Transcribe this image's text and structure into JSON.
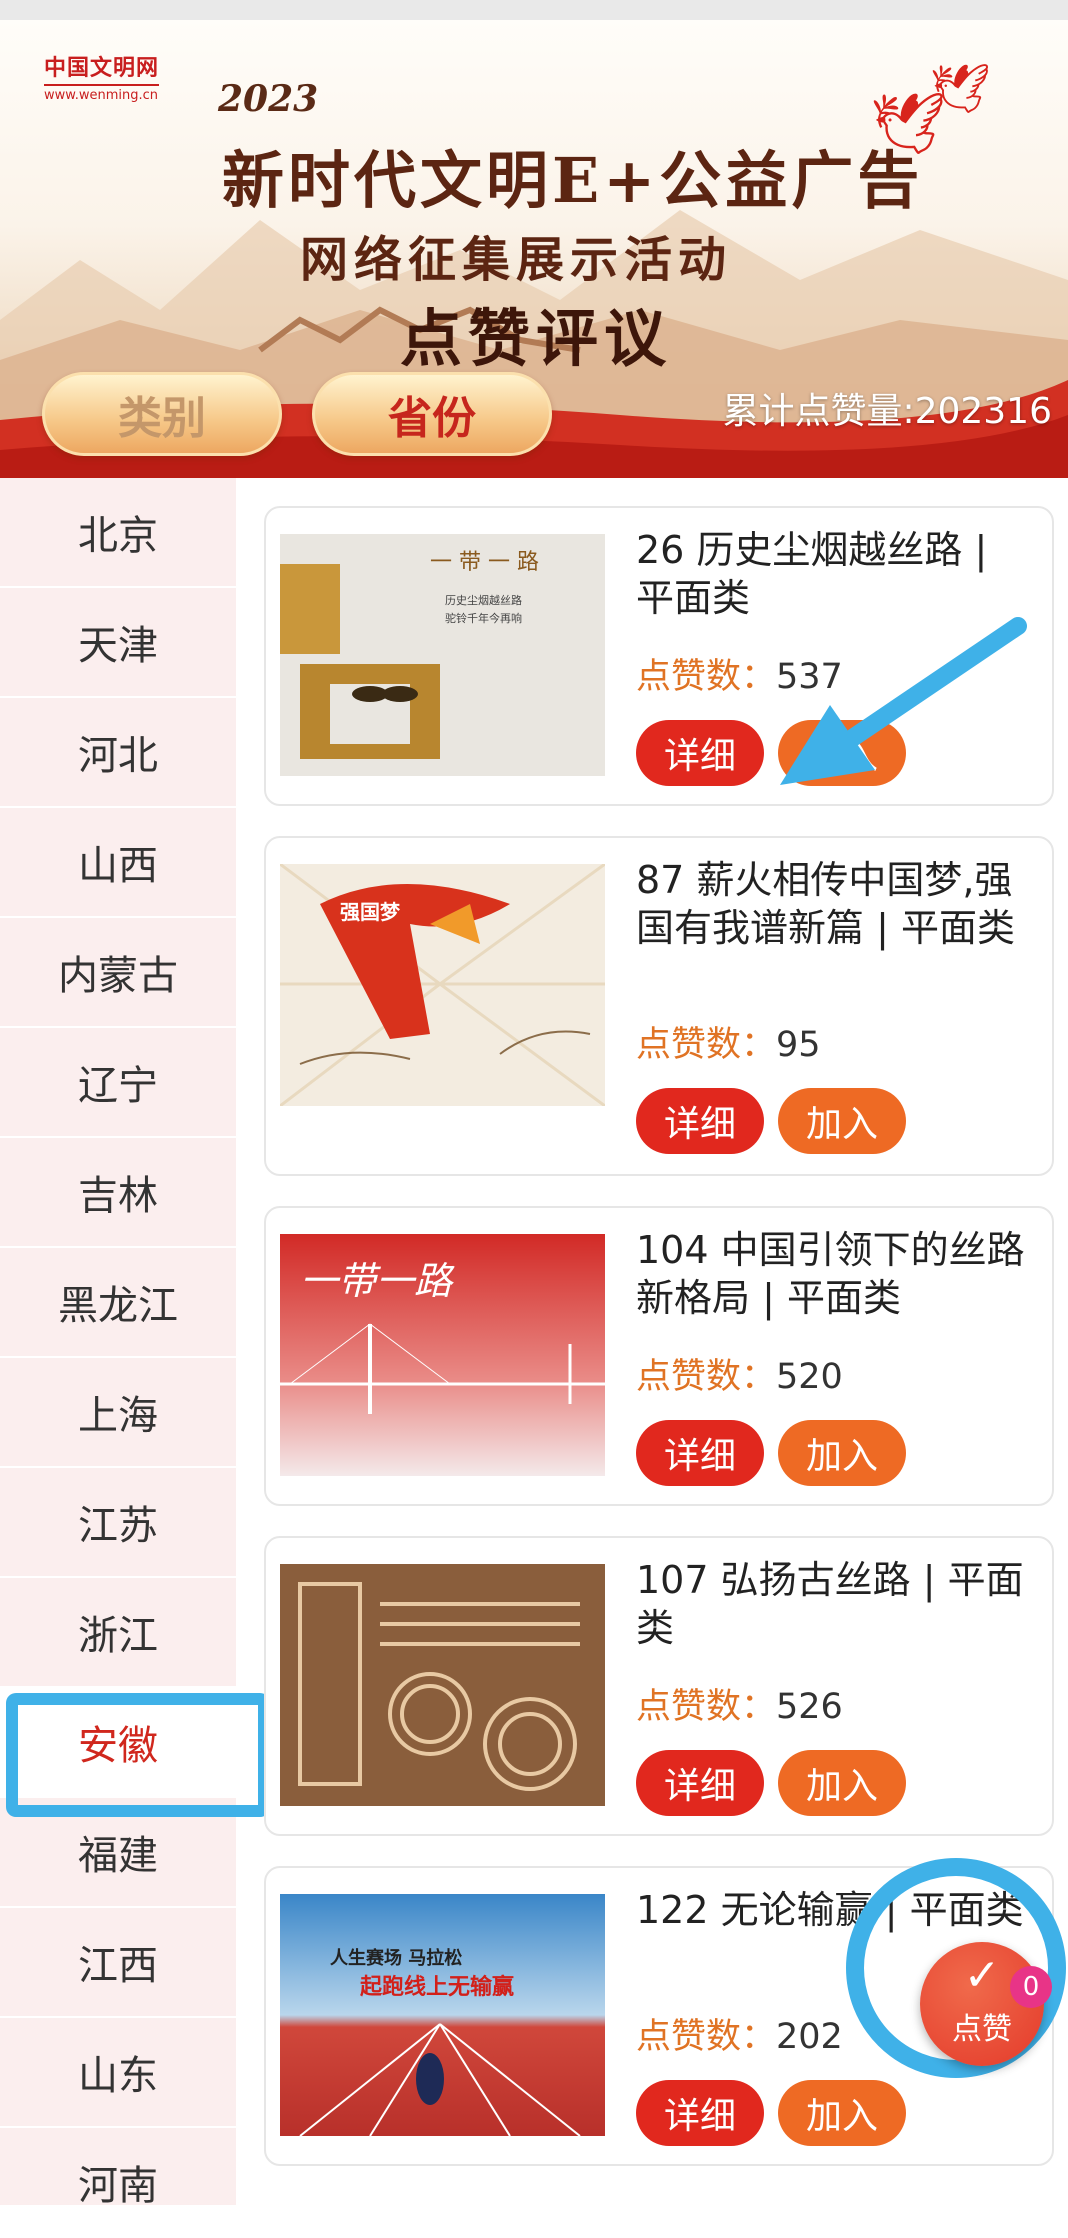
{
  "banner": {
    "logo_cn": "中国文明网",
    "logo_en": "www.wenming.cn",
    "year": "2023",
    "title_line1": "新时代文明E+公益广告",
    "title_line2": "网络征集展示活动",
    "title_line3": "点赞评议",
    "tab_category": "类别",
    "tab_province": "省份",
    "total_likes": "累计点赞量:202316"
  },
  "sidebar": {
    "items": [
      {
        "label": "北京"
      },
      {
        "label": "天津"
      },
      {
        "label": "河北"
      },
      {
        "label": "山西"
      },
      {
        "label": "内蒙古"
      },
      {
        "label": "辽宁"
      },
      {
        "label": "吉林"
      },
      {
        "label": "黑龙江"
      },
      {
        "label": "上海"
      },
      {
        "label": "江苏"
      },
      {
        "label": "浙江"
      },
      {
        "label": "安徽"
      },
      {
        "label": "福建"
      },
      {
        "label": "江西"
      },
      {
        "label": "山东"
      },
      {
        "label": "河南"
      }
    ],
    "active_index": 11
  },
  "cards": [
    {
      "title": "26 历史尘烟越丝路 | 平面类",
      "likes_label": "点赞数：",
      "likes": "537",
      "detail": "详细",
      "add": "加入"
    },
    {
      "title": "87 薪火相传中国梦,强国有我谱新篇 | 平面类",
      "likes_label": "点赞数：",
      "likes": "95",
      "detail": "详细",
      "add": "加入"
    },
    {
      "title": "104 中国引领下的丝路新格局 | 平面类",
      "likes_label": "点赞数：",
      "likes": "520",
      "detail": "详细",
      "add": "加入"
    },
    {
      "title": "107 弘扬古丝路 | 平面类",
      "likes_label": "点赞数：",
      "likes": "526",
      "detail": "详细",
      "add": "加入"
    },
    {
      "title": "122 无论输赢 | 平面类",
      "likes_label": "点赞数：",
      "likes": "202",
      "detail": "详细",
      "add": "加入"
    }
  ],
  "fab": {
    "label": "点赞",
    "count": "0"
  },
  "colors": {
    "accent_red": "#e1281e",
    "accent_orange": "#ee6a24",
    "highlight_blue": "#3fb1e8"
  }
}
